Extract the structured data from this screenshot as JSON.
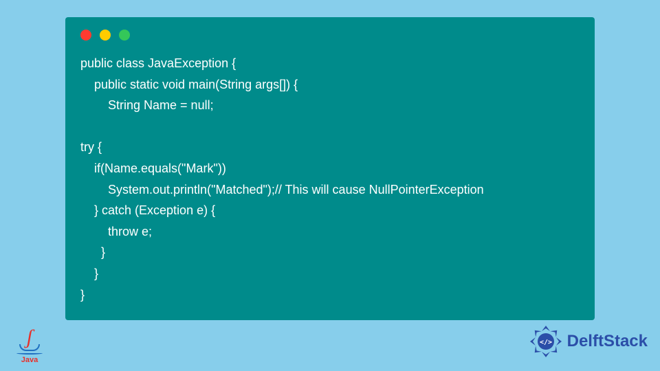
{
  "code": {
    "lines": [
      "public class JavaException {",
      "    public static void main(String args[]) {",
      "        String Name = null;",
      "",
      "try {",
      "    if(Name.equals(\"Mark\"))",
      "        System.out.println(\"Matched\");// This will cause NullPointerException",
      "    } catch (Exception e) {",
      "        throw e;",
      "      }",
      "    }",
      "}"
    ]
  },
  "logos": {
    "java_label": "Java",
    "delft_label": "DelftStack"
  }
}
